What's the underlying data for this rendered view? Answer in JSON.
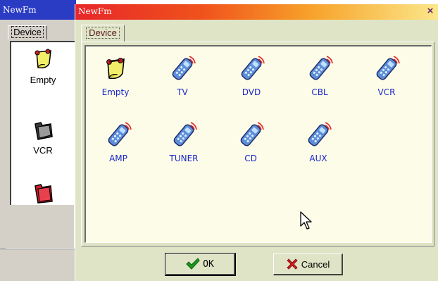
{
  "back_window": {
    "title": "NewFm",
    "tab_label": "Device",
    "items": [
      {
        "label": "Empty",
        "icon": "note-pin-icon"
      },
      {
        "label": "VCR",
        "icon": "folder-dark-icon"
      },
      {
        "label": "",
        "icon": "folder-red-icon"
      }
    ]
  },
  "dialog": {
    "title": "NewFm",
    "close_label": "×",
    "tab_label": "Device",
    "devices": [
      {
        "label": "Empty",
        "icon": "note-pin-icon"
      },
      {
        "label": "TV",
        "icon": "remote-control-icon"
      },
      {
        "label": "DVD",
        "icon": "remote-control-icon"
      },
      {
        "label": "CBL",
        "icon": "remote-control-icon"
      },
      {
        "label": "VCR",
        "icon": "remote-control-icon"
      },
      {
        "label": "AMP",
        "icon": "remote-control-icon"
      },
      {
        "label": "TUNER",
        "icon": "remote-control-icon"
      },
      {
        "label": "CD",
        "icon": "remote-control-icon"
      },
      {
        "label": "AUX",
        "icon": "remote-control-icon"
      }
    ],
    "ok_label": "OK",
    "cancel_label": "Cancel"
  },
  "colors": {
    "title_gradient": [
      "#e8262a",
      "#fbe78a"
    ],
    "device_label": "#1a25c8",
    "dialog_bg": "#dfe4c6"
  }
}
